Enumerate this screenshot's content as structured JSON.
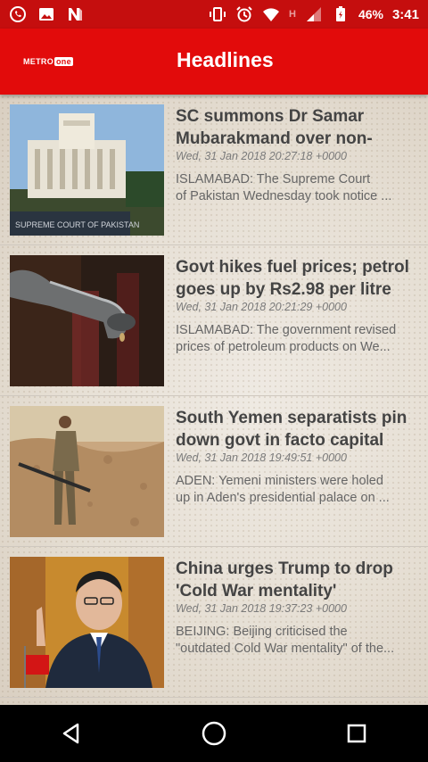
{
  "status_bar": {
    "time": "3:41",
    "battery": "46%",
    "network": "H",
    "left_icons": [
      "whatsapp-icon",
      "gallery-icon",
      "notification-n-icon"
    ],
    "right_icons": [
      "vibrate-icon",
      "alarm-icon",
      "wifi-icon",
      "signal-icon",
      "battery-icon"
    ]
  },
  "app_bar": {
    "logo_part1": "METRO",
    "logo_part2": "one",
    "title": "Headlines"
  },
  "articles": [
    {
      "headline": "SC summons Dr Samar Mubarakmand over non-",
      "date": "Wed, 31 Jan 2018 20:27:18 +0000",
      "summary_line1": "ISLAMABAD: The Supreme Court",
      "summary_line2": "of Pakistan Wednesday took notice ...",
      "thumbnail_caption": "SUPREME COURT OF PAKISTAN"
    },
    {
      "headline": "Govt hikes fuel prices; petrol goes up by Rs2.98 per litre",
      "date": "Wed, 31 Jan 2018 20:21:29 +0000",
      "summary_line1": "ISLAMABAD: The government revised",
      "summary_line2": "prices of petroleum products on We..."
    },
    {
      "headline": "South Yemen separatists pin down govt in facto capital",
      "date": "Wed, 31 Jan 2018 19:49:51 +0000",
      "summary_line1": "ADEN: Yemeni ministers were holed",
      "summary_line2": "up in Aden's presidential palace on ..."
    },
    {
      "headline": "China urges Trump to drop 'Cold War mentality'",
      "date": "Wed, 31 Jan 2018 19:37:23 +0000",
      "summary_line1": "BEIJING: Beijing criticised the",
      "summary_line2": "\"outdated Cold War mentality\" of the..."
    }
  ],
  "nav_bar": {
    "icons": [
      "back-icon",
      "home-icon",
      "recents-icon"
    ]
  },
  "colors": {
    "status_bar": "#c50e0e",
    "app_bar": "#e20b0b",
    "headline": "#444444",
    "date": "#7a7a7a",
    "summary": "#666666"
  }
}
